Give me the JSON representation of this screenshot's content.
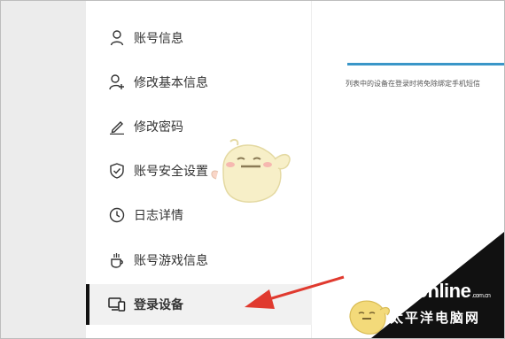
{
  "sidebar": {
    "items": [
      {
        "label": "账号信息",
        "icon": "user-icon"
      },
      {
        "label": "修改基本信息",
        "icon": "user-edit-icon"
      },
      {
        "label": "修改密码",
        "icon": "pencil-icon"
      },
      {
        "label": "账号安全设置",
        "icon": "shield-check-icon"
      },
      {
        "label": "日志详情",
        "icon": "clock-icon"
      },
      {
        "label": "账号游戏信息",
        "icon": "cup-icon"
      },
      {
        "label": "登录设备",
        "icon": "devices-icon",
        "active": true
      }
    ]
  },
  "main": {
    "hint": "列表中的设备在登录时将免除绑定手机短信"
  },
  "watermark": {
    "brand": "PConline",
    "suffix": ".com.cn",
    "chinese": "太平洋电脑网"
  },
  "colors": {
    "accent_line": "#3a96c8",
    "arrow": "#e03a2f",
    "active_bar": "#111111"
  }
}
